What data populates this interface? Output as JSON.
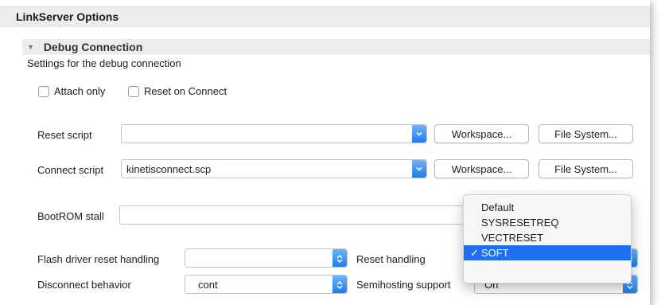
{
  "header": {
    "title": "LinkServer Options"
  },
  "section": {
    "title": "Debug Connection",
    "description": "Settings for the debug connection"
  },
  "checkboxes": {
    "attach_only": "Attach only",
    "reset_on_connect": "Reset on Connect"
  },
  "reset_script": {
    "label": "Reset script",
    "value": ""
  },
  "connect_script": {
    "label": "Connect script",
    "value": "kinetisconnect.scp"
  },
  "buttons": {
    "workspace": "Workspace...",
    "file_system": "File System..."
  },
  "bootrom": {
    "label": "BootROM stall",
    "value": ""
  },
  "flash_reset": {
    "label": "Flash driver reset handling",
    "value": ""
  },
  "reset_handling": {
    "label": "Reset handling"
  },
  "disconnect": {
    "label": "Disconnect behavior",
    "value": "cont"
  },
  "semihosting": {
    "label": "Semihosting support",
    "value": "On"
  },
  "reset_menu": {
    "items": [
      "Default",
      "SYSRESETREQ",
      "VECTRESET",
      "SOFT"
    ],
    "selected": "SOFT",
    "check_mark": "✓"
  },
  "colors": {
    "accent": "#1f6ff0",
    "header_bg": "#ececec"
  }
}
